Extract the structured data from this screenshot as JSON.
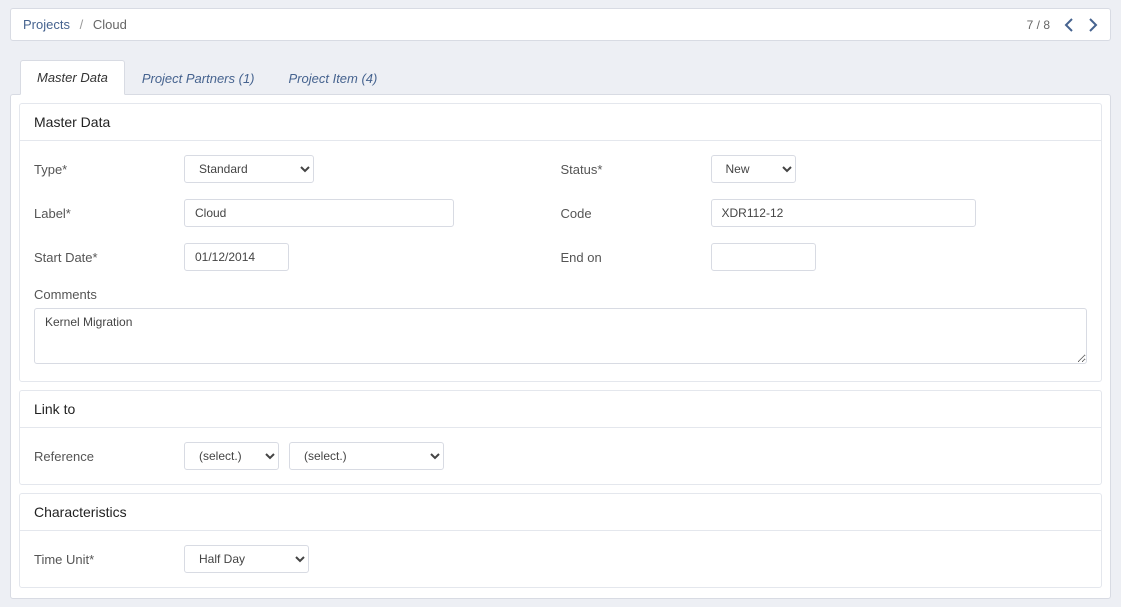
{
  "header": {
    "breadcrumb_root": "Projects",
    "breadcrumb_current": "Cloud",
    "pager_text": "7 / 8"
  },
  "tabs": [
    {
      "label": "Master Data"
    },
    {
      "label": "Project Partners (1)"
    },
    {
      "label": "Project Item (4)"
    }
  ],
  "master": {
    "title": "Master Data",
    "type_label": "Type*",
    "type_value": "Standard",
    "status_label": "Status*",
    "status_value": "New",
    "label_label": "Label*",
    "label_value": "Cloud",
    "code_label": "Code",
    "code_value": "XDR112-12",
    "start_label": "Start Date*",
    "start_value": "01/12/2014",
    "end_label": "End on",
    "end_value": "",
    "comments_label": "Comments",
    "comments_value": "Kernel Migration"
  },
  "linkto": {
    "title": "Link to",
    "reference_label": "Reference",
    "select1_value": "(select.)",
    "select2_value": "(select.)"
  },
  "characteristics": {
    "title": "Characteristics",
    "timeunit_label": "Time Unit*",
    "timeunit_value": "Half Day"
  }
}
